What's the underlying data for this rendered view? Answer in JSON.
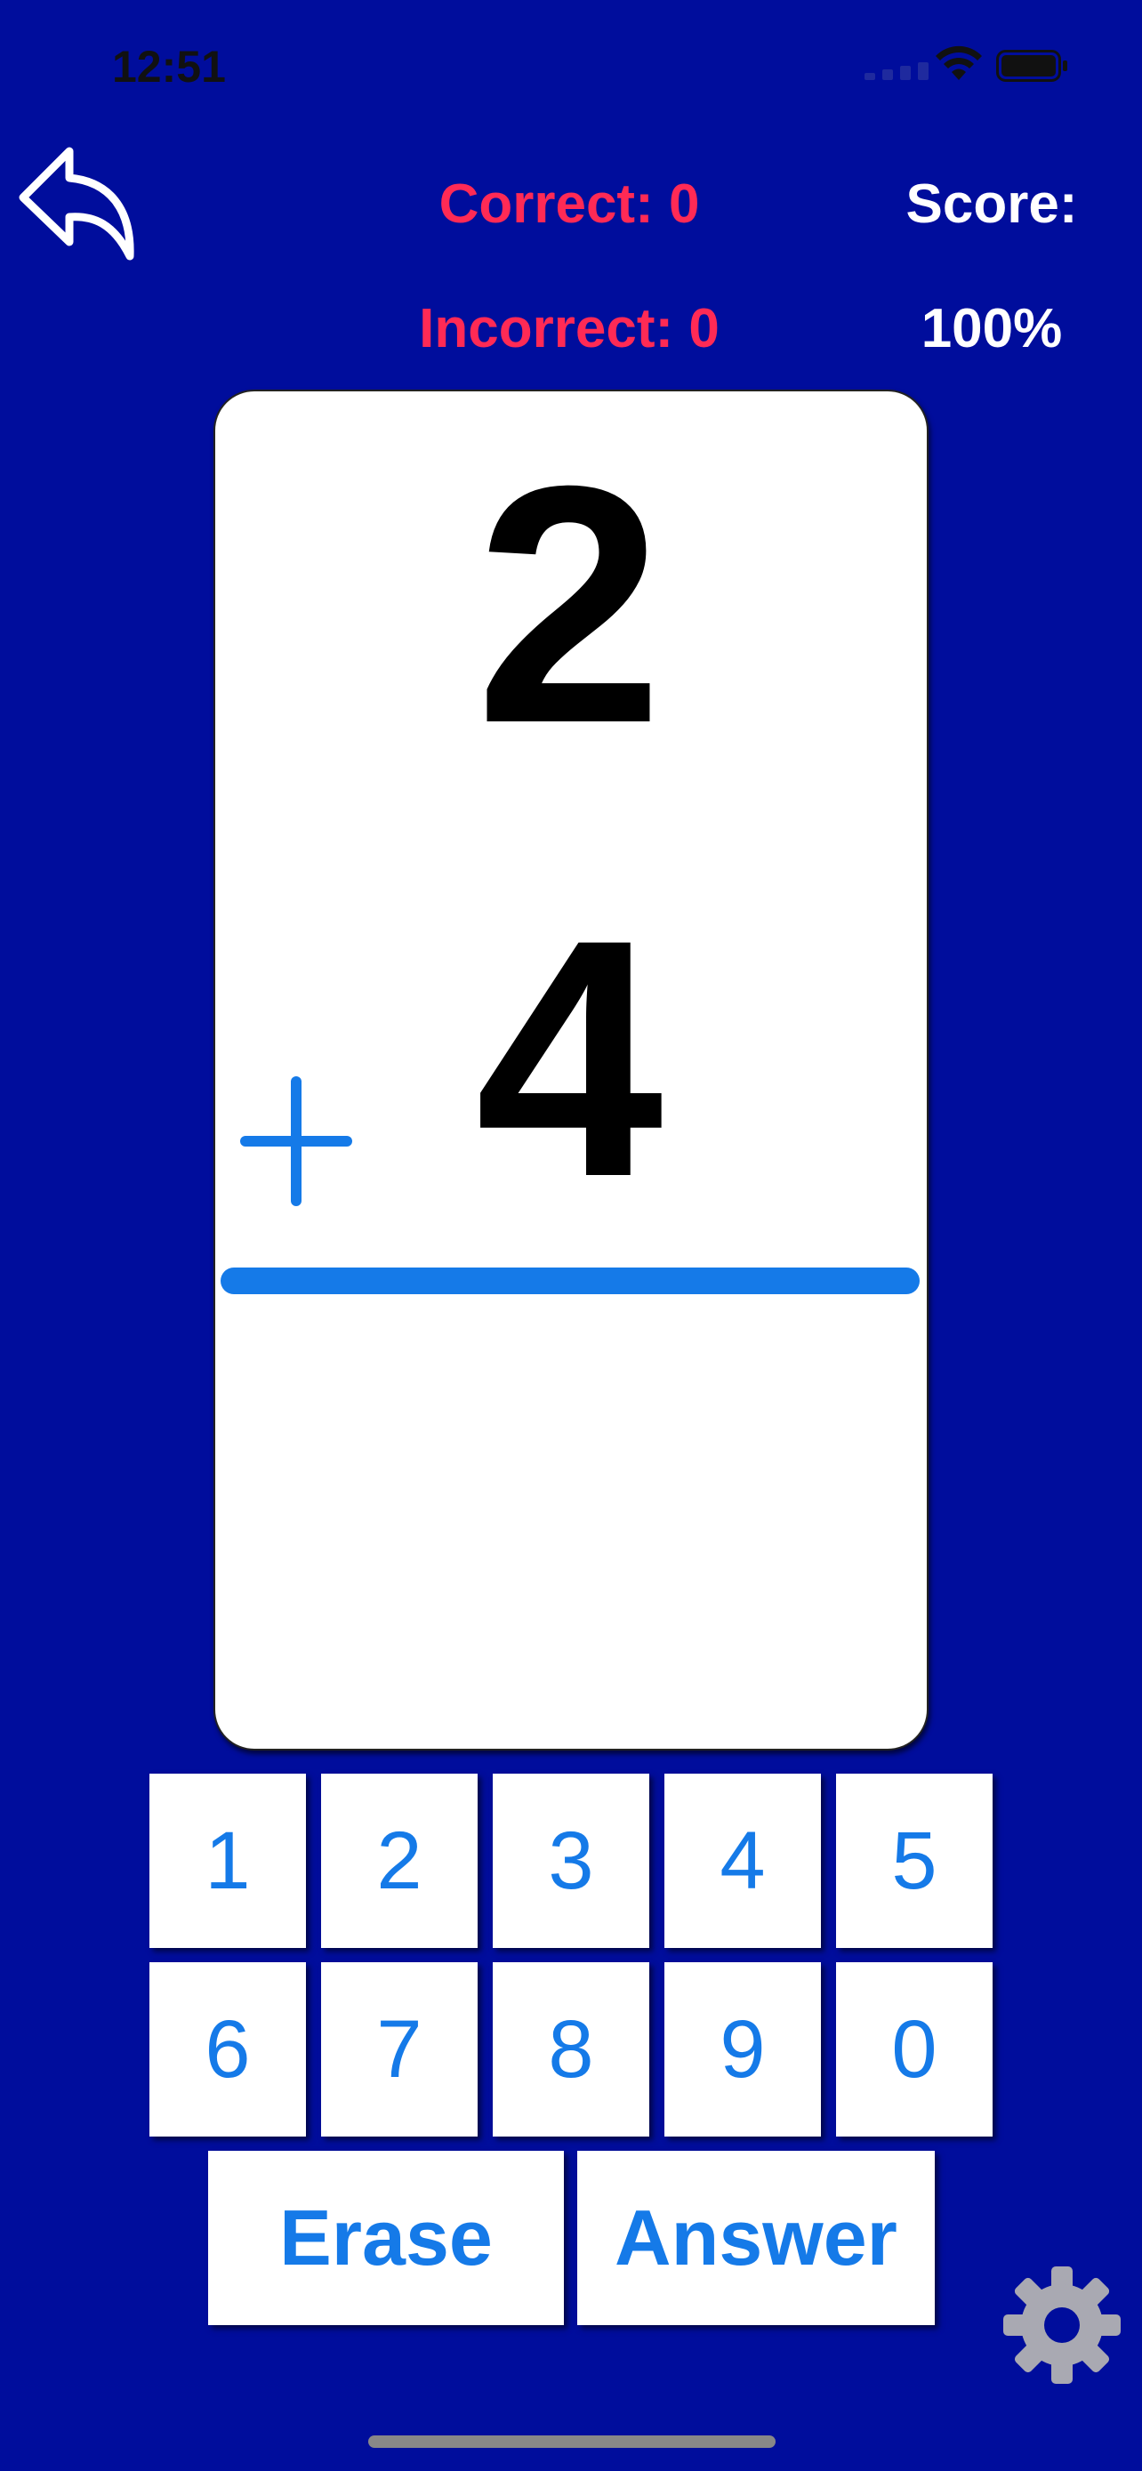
{
  "status_bar": {
    "time": "12:51"
  },
  "header": {
    "correct_text": "Correct: 0",
    "incorrect_text": "Incorrect: 0",
    "score_label": "Score:",
    "score_value": "100%"
  },
  "card": {
    "top_number": "2",
    "bottom_number": "4",
    "operator": "+",
    "answer": ""
  },
  "keypad": {
    "row1": [
      "1",
      "2",
      "3",
      "4",
      "5"
    ],
    "row2": [
      "6",
      "7",
      "8",
      "9",
      "0"
    ],
    "erase_label": "Erase",
    "answer_label": "Answer"
  },
  "icons": {
    "back": "back-arrow-icon",
    "settings": "gear-icon",
    "wifi": "wifi-icon",
    "battery": "battery-icon",
    "signal": "cellular-signal-icon"
  },
  "colors": {
    "background": "#000d9c",
    "accent_red": "#ff2a55",
    "accent_blue": "#157ae8",
    "card": "#ffffff"
  }
}
